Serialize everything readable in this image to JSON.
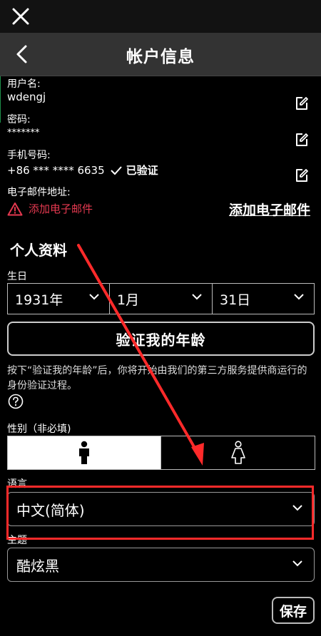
{
  "header": {
    "title": "帐户信息"
  },
  "fields": {
    "username": {
      "label": "用户名:",
      "value": "wdengj"
    },
    "password": {
      "label": "密码:",
      "value": "*******"
    },
    "phone": {
      "label": "手机号码:",
      "value": "+86 *** **** 6635",
      "verified": "已验证"
    },
    "email": {
      "label": "电子邮件地址:",
      "warning": "添加电子邮件",
      "add_link": "添加电子邮件"
    }
  },
  "profile": {
    "section_title": "个人资料",
    "birthday": {
      "label": "生日",
      "year": "1931年",
      "month": "1月",
      "day": "31日"
    },
    "verify_button": "验证我的年龄",
    "verify_note": "按下“验证我的年龄”后，你将开始由我们的第三方服务提供商运行的身份验证过程。",
    "gender": {
      "label": "性别（非必填)",
      "selected": "male"
    },
    "language": {
      "label": "语言",
      "value": "中文(简体)"
    },
    "theme": {
      "label": "主题",
      "value": "酷炫黑"
    },
    "save_button": "保存"
  },
  "annotation_color": "#ff2a2a"
}
